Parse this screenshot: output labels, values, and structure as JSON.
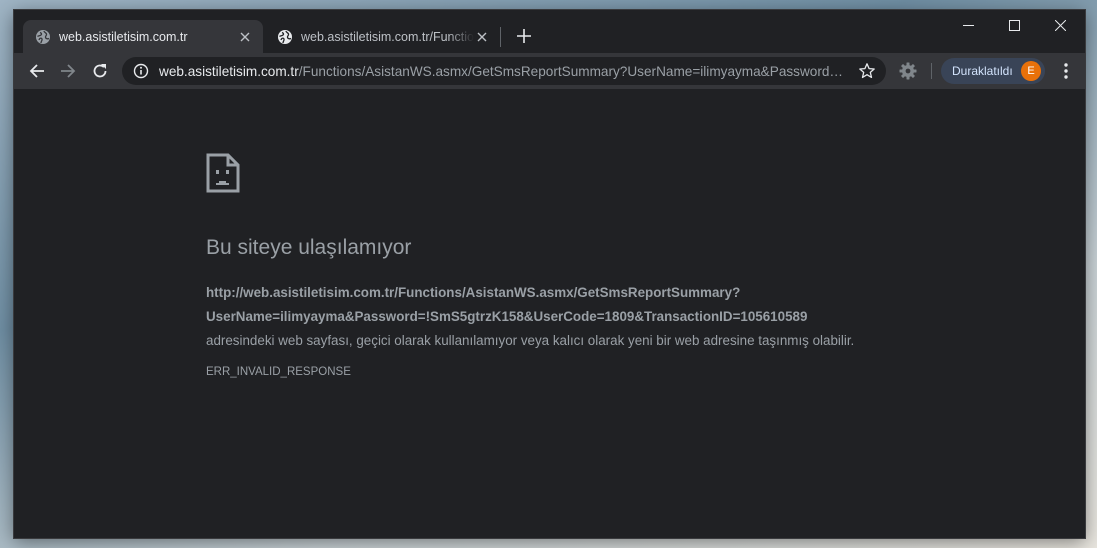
{
  "tabs": [
    {
      "title": "web.asistiletisim.com.tr",
      "active": true
    },
    {
      "title": "web.asistiletisim.com.tr/Functions/AsistanWS.asmx/GetSmsReportSummary",
      "active": false
    }
  ],
  "toolbar": {
    "url_host": "web.asistiletisim.com.tr",
    "url_path": "/Functions/AsistanWS.asmx/GetSmsReportSummary?UserName=ilimyayma&Password…",
    "profile_label": "Duraklatıldı",
    "profile_initial": "E"
  },
  "error_page": {
    "title": "Bu siteye ulaşılamıyor",
    "url_line1": "http://web.asistiletisim.com.tr/Functions/AsistanWS.asmx/GetSmsReportSummary?",
    "url_line2": "UserName=ilimyayma&Password=!SmS5gtrzK158&UserCode=1809&TransactionID=105610589",
    "description": "adresindeki web sayfası, geçici olarak kullanılamıyor veya kalıcı olarak yeni bir web adresine taşınmış olabilir.",
    "code": "ERR_INVALID_RESPONSE"
  },
  "icons": {
    "tab_favicon": "globe-icon",
    "omnibox": "info-icon",
    "bookmark": "star-icon",
    "extension": "gear-icon",
    "error": "sad-page-icon"
  },
  "colors": {
    "frame": "#202124",
    "toolbar": "#35363a",
    "profile_bg": "#394457",
    "avatar": "#e8710a"
  }
}
